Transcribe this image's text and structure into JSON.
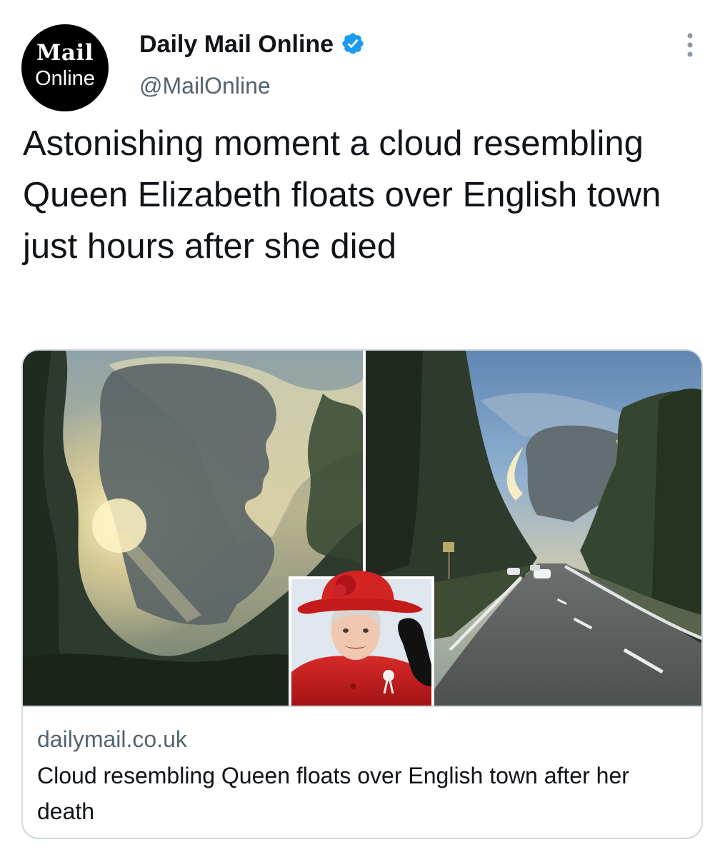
{
  "account": {
    "avatar_line1": "Mail",
    "avatar_line2": "Online",
    "display_name": "Daily Mail Online",
    "handle": "@MailOnline",
    "verified": true
  },
  "tweet": {
    "text": "Astonishing moment a cloud resembling Queen Elizabeth floats over English town just hours after she died"
  },
  "link_card": {
    "domain": "dailymail.co.uk",
    "title": "Cloud resembling Queen floats over English town after her death"
  },
  "icons": {
    "verified": "verified-badge-icon",
    "more": "more-options-icon"
  },
  "colors": {
    "verified_blue": "#1d9bf0",
    "secondary_text": "#536471",
    "border": "#cfd9de"
  }
}
